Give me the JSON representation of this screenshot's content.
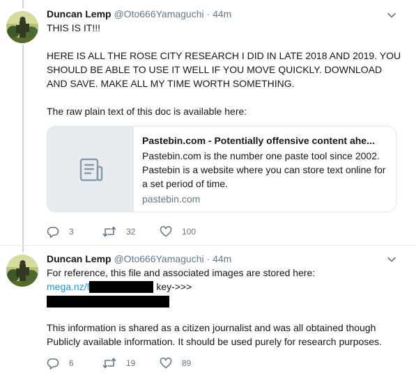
{
  "tweets": [
    {
      "author": {
        "name": "Duncan Lemp",
        "handle": "@Oto666Yamaguchi",
        "separator": "·",
        "time": "44m"
      },
      "text": {
        "line1": "THIS IS IT!!!",
        "para2": "HERE IS ALL THE ROSE CITY RESEARCH I DID IN LATE 2018 AND 2019. YOU SHOULD BE ABLE TO USE IT WELL IF YOU MOVE QUICKLY. DOWNLOAD AND SAVE. MAKE ALL MY TIME WORTH SOMETHING.",
        "para3": "The raw plain text of this doc is available here:"
      },
      "card": {
        "title": "Pastebin.com - Potentially offensive content ahe...",
        "description": "Pastebin.com is the number one paste tool since 2002. Pastebin is a website where you can store text online for a set period of time.",
        "domain": "pastebin.com",
        "thumb_icon": "document-icon"
      },
      "actions": {
        "replies": "3",
        "retweets": "32",
        "likes": "100"
      }
    },
    {
      "author": {
        "name": "Duncan Lemp",
        "handle": "@Oto666Yamaguchi",
        "separator": "·",
        "time": "44m"
      },
      "text": {
        "line1": "For reference, this file and associated images are stored here:",
        "link_prefix": "mega.nz/f",
        "after_link": " key->>>",
        "para2": "This information is shared as a citizen journalist and was all obtained though Publicly available information. It should be used purely for research purposes."
      },
      "actions": {
        "replies": "6",
        "retweets": "19",
        "likes": "89"
      }
    }
  ],
  "colors": {
    "text": "#14171a",
    "secondary": "#657786",
    "link": "#1b95e0",
    "border": "#e1e8ed",
    "thread_line": "#ccd6dd",
    "card_thumb_bg": "#e6ecf0"
  },
  "icons": [
    "reply-icon",
    "retweet-icon",
    "like-icon",
    "caret-down-icon",
    "document-icon",
    "avatar"
  ]
}
